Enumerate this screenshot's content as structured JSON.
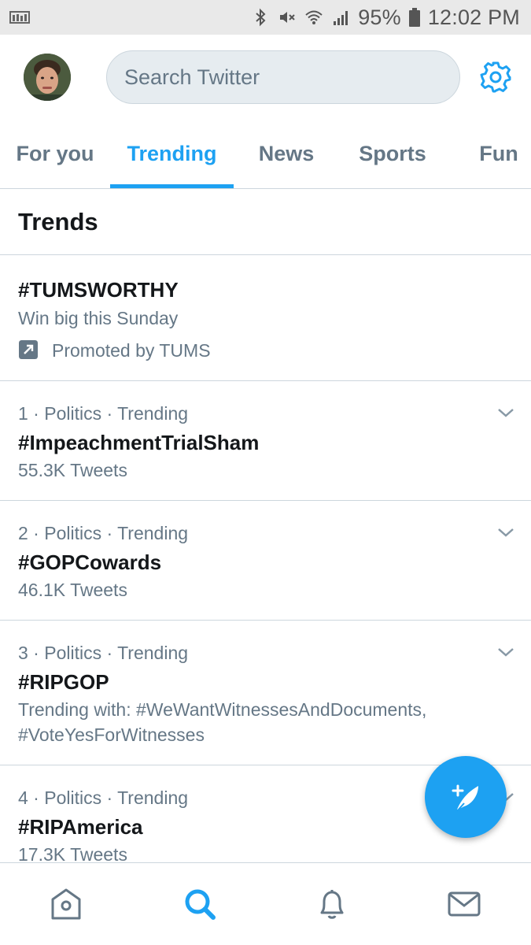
{
  "status_bar": {
    "battery": "95%",
    "time": "12:02 PM"
  },
  "header": {
    "search_placeholder": "Search Twitter"
  },
  "tabs": [
    {
      "label": "For you"
    },
    {
      "label": "Trending",
      "active": true
    },
    {
      "label": "News"
    },
    {
      "label": "Sports"
    },
    {
      "label": "Fun"
    }
  ],
  "trends_title": "Trends",
  "promoted": {
    "name": "#TUMSWORTHY",
    "description": "Win big this Sunday",
    "promoted_by": "Promoted by TUMS"
  },
  "trends": [
    {
      "meta": "1 · Politics · Trending",
      "name": "#ImpeachmentTrialSham",
      "count": "55.3K Tweets"
    },
    {
      "meta": "2 · Politics · Trending",
      "name": "#GOPCowards",
      "count": "46.1K Tweets"
    },
    {
      "meta": "3 · Politics · Trending",
      "name": "#RIPGOP",
      "count_line1": "Trending with: #WeWantWitnessesAndDocuments,",
      "count_line2": "#VoteYesForWitnesses"
    },
    {
      "meta": "4 · Politics · Trending",
      "name": "#RIPAmerica",
      "count": "17.3K Tweets"
    }
  ],
  "colors": {
    "accent": "#1da1f2",
    "secondary_text": "#657786",
    "primary_text": "#14171a",
    "divider": "#ccd6dd"
  },
  "icons": {
    "nav": [
      "home-icon",
      "search-icon",
      "notifications-icon",
      "messages-icon"
    ],
    "fab": "compose-tweet-icon",
    "settings": "gear-icon"
  }
}
